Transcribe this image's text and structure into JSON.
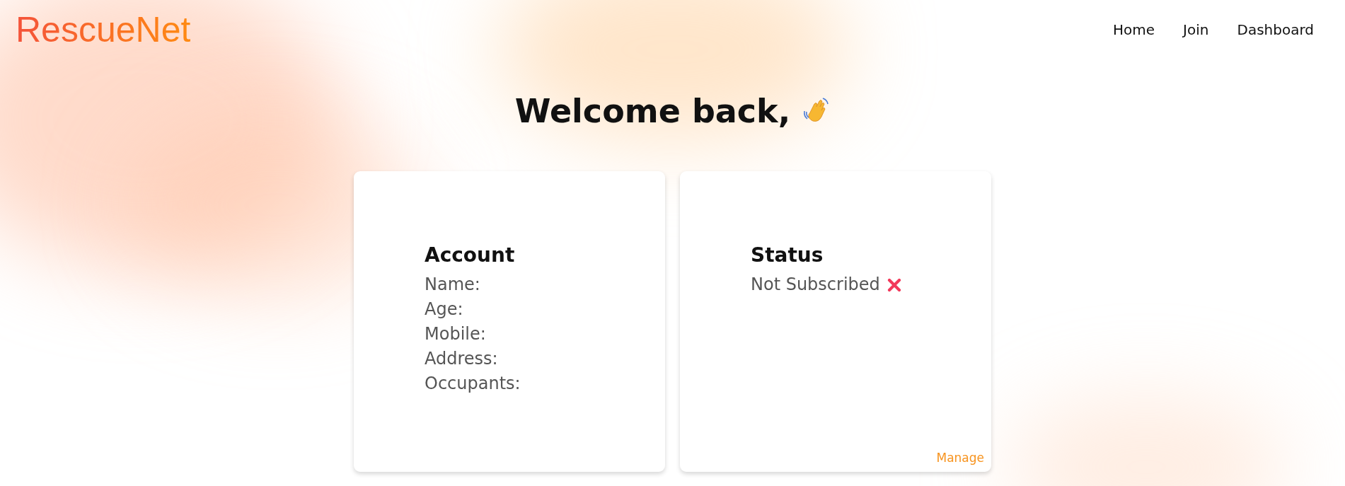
{
  "brand": "RescueNet",
  "nav": [
    {
      "label": "Home"
    },
    {
      "label": "Join"
    },
    {
      "label": "Dashboard"
    }
  ],
  "heading": "Welcome back,",
  "account": {
    "title": "Account",
    "fields": [
      "Name:",
      "Age:",
      "Mobile:",
      "Address:",
      "Occupants:"
    ]
  },
  "status": {
    "title": "Status",
    "text": "Not Subscribed",
    "subscribed": false,
    "link": "Manage"
  }
}
